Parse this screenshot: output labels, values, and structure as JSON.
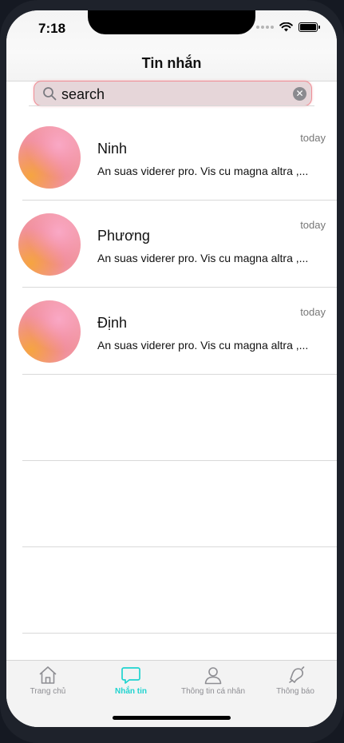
{
  "status_bar": {
    "time": "7:18"
  },
  "header": {
    "title": "Tin nhắn"
  },
  "search": {
    "value": "search"
  },
  "conversations": [
    {
      "name": "Ninh",
      "preview": "An suas viderer pro. Vis cu magna altra ,...",
      "time": "today"
    },
    {
      "name": "Phương",
      "preview": "An suas viderer pro. Vis cu magna altra ,...",
      "time": "today"
    },
    {
      "name": "Định",
      "preview": "An suas viderer pro. Vis cu magna altra ,...",
      "time": "today"
    }
  ],
  "tabs": [
    {
      "label": "Trang chủ",
      "icon": "home-icon",
      "active": false
    },
    {
      "label": "Nhắn tin",
      "icon": "chat-icon",
      "active": true
    },
    {
      "label": "Thông tin cá nhân",
      "icon": "person-icon",
      "active": false
    },
    {
      "label": "Thông báo",
      "icon": "bell-icon",
      "active": false
    }
  ],
  "colors": {
    "accent": "#1fd3cf",
    "search_border": "#f08e96",
    "search_bg": "#e6d6d9"
  }
}
